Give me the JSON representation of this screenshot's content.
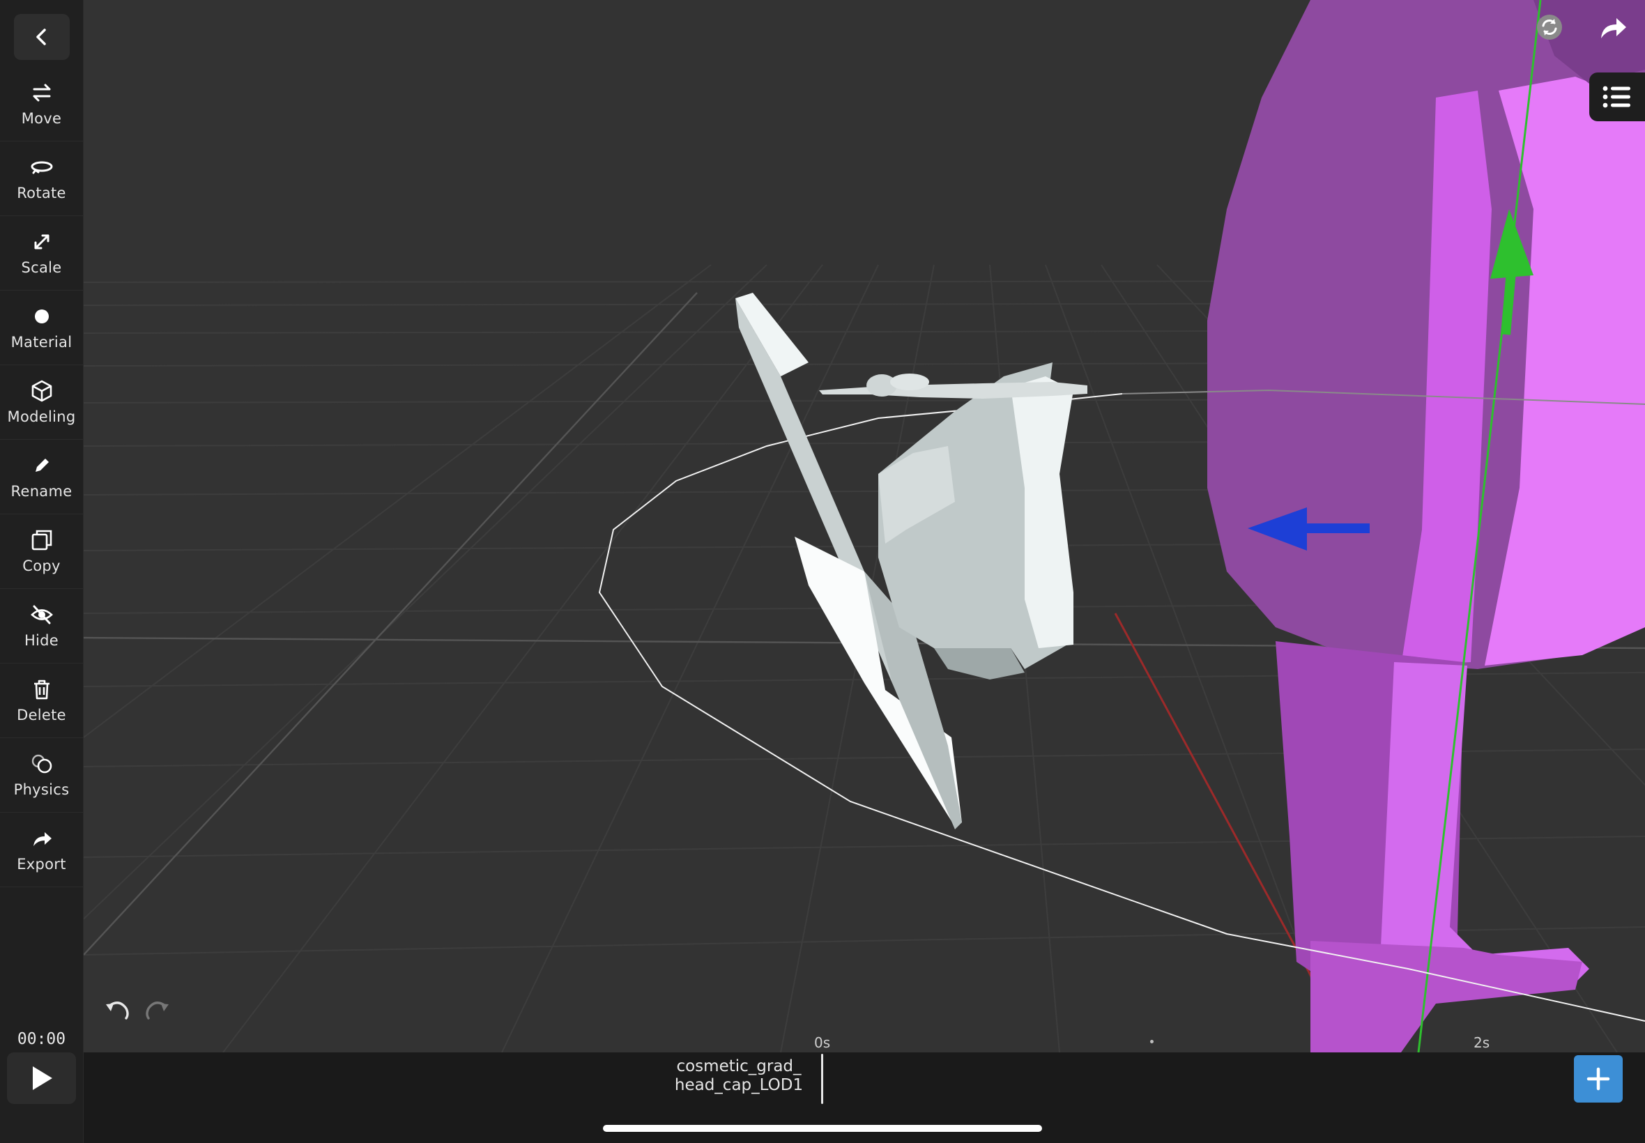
{
  "toolbar": {
    "back_icon": "chevron-left-icon",
    "tools": [
      {
        "label": "Move",
        "icon": "move-arrows-icon"
      },
      {
        "label": "Rotate",
        "icon": "rotate-icon"
      },
      {
        "label": "Scale",
        "icon": "scale-diagonal-icon"
      },
      {
        "label": "Material",
        "icon": "material-dot-icon"
      },
      {
        "label": "Modeling",
        "icon": "cube-icon"
      },
      {
        "label": "Rename",
        "icon": "pencil-icon"
      },
      {
        "label": "Copy",
        "icon": "copy-icon"
      },
      {
        "label": "Hide",
        "icon": "eye-slash-icon"
      },
      {
        "label": "Delete",
        "icon": "trash-icon"
      },
      {
        "label": "Physics",
        "icon": "physics-spheres-icon"
      },
      {
        "label": "Export",
        "icon": "share-arrow-icon"
      }
    ]
  },
  "playback": {
    "time": "00:00",
    "play_icon": "play-icon"
  },
  "viewport": {
    "undo_icon": "undo-icon",
    "redo_icon": "redo-icon",
    "sync_icon": "sync-icon",
    "share_icon": "share-arrow-icon",
    "outline_icon": "list-icon",
    "colors": {
      "background": "#333333",
      "grid": "#3d3d3d",
      "character": "#b050c8",
      "selected_object": "#dfe6e6",
      "axis_y": "#2ec02e",
      "axis_z": "#1d3fd6",
      "axis_x": "#b03030"
    }
  },
  "timeline": {
    "ruler": {
      "start": "0s",
      "mark": "2s"
    },
    "track_label_line1": "cosmetic_grad_",
    "track_label_line2": "head_cap_LOD1",
    "add_icon": "plus-icon",
    "add_color": "#3d8fd6"
  }
}
